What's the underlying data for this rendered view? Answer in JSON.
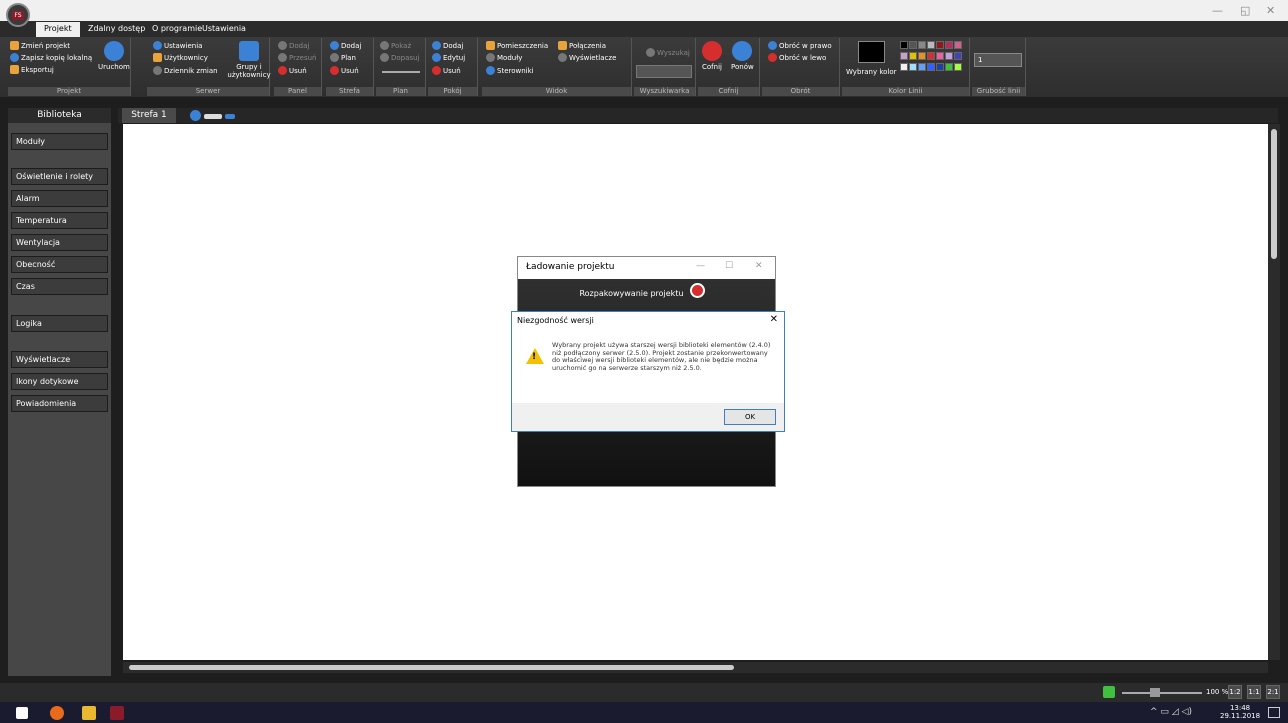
{
  "app": {
    "logo_text": "FS"
  },
  "window": {
    "minimize": "—",
    "restore": "◱",
    "close": "✕"
  },
  "menu": [
    "Projekt",
    "Zdalny dostęp",
    "O programie",
    "Ustawienia"
  ],
  "ribbon": {
    "projekt": {
      "label": "Projekt",
      "items": [
        "Zmień projekt",
        "Zapisz kopię lokalną",
        "Eksportuj",
        "Uruchom"
      ]
    },
    "serwer": {
      "label": "Serwer",
      "items": [
        "Ustawienia",
        "Użytkownicy",
        "Dziennik zmian",
        "Grupy i użytkownicy"
      ]
    },
    "panel": {
      "label": "Panel",
      "items": [
        "Dodaj",
        "Przesuń",
        "Usuń"
      ]
    },
    "strefa": {
      "label": "Strefa",
      "items": [
        "Dodaj",
        "Plan",
        "Usuń"
      ]
    },
    "plan": {
      "label": "Plan",
      "items": [
        "Pokaż",
        "Dopasuj"
      ]
    },
    "pokoj": {
      "label": "Pokój",
      "items": [
        "Dodaj",
        "Edytuj",
        "Usuń"
      ]
    },
    "widok": {
      "label": "Widok",
      "items": [
        "Pomieszczenia",
        "Połączenia",
        "Moduły",
        "Wyświetlacze",
        "Sterowniki"
      ]
    },
    "wyszukiwarka": {
      "label": "Wyszukiwarka",
      "items": [
        "Wyszukaj"
      ]
    },
    "cofnij": {
      "label": "Cofnij",
      "items": [
        "Cofnij",
        "Ponów"
      ]
    },
    "obrot": {
      "label": "Obrót",
      "items": [
        "Obróć w prawo",
        "Obróć w lewo"
      ]
    },
    "kolor": {
      "label": "Kolor Linii",
      "items": [
        "Wybrany kolor"
      ]
    },
    "grubosc": {
      "label": "Grubość linii",
      "value": "1"
    }
  },
  "palette": [
    "#000000",
    "#555555",
    "#888888",
    "#bbbbbb",
    "#8b1a1a",
    "#b03060",
    "#d06090",
    "#c8a0c8",
    "#e0c000",
    "#e89020",
    "#d03030",
    "#f060a0",
    "#c0a0e0",
    "#4040c0",
    "#f0f0f0",
    "#a0e0ff",
    "#60a0ff",
    "#3060ff",
    "#2040a0",
    "#40c040",
    "#a0ff40"
  ],
  "sidebar": {
    "header": "Biblioteka",
    "items": [
      "Moduły",
      "Oświetlenie i rolety",
      "Alarm",
      "Temperatura",
      "Wentylacja",
      "Obecność",
      "Czas",
      "Logika",
      "Wyświetlacze",
      "Ikony dotykowe",
      "Powiadomienia"
    ]
  },
  "tabs": [
    "Strefa 1"
  ],
  "loading": {
    "title": "Ładowanie projektu",
    "status": "Rozpakowywanie projektu"
  },
  "dialog": {
    "title": "Niezgodność wersji",
    "message": "Wybrany projekt używa starszej wersji biblioteki elementów (2.4.0) niż podłączony serwer (2.5.0). Projekt zostanie przekonwertowany do właściwej wersji biblioteki elementów, ale nie będzie można uruchomić go na serwerze starszym niż 2.5.0.",
    "ok": "OK"
  },
  "status": {
    "zoom": "100 %",
    "z12": "1:2",
    "z11": "1:1",
    "z21": "2:1"
  },
  "taskbar": {
    "time": "13:48",
    "date": "29.11.2018"
  }
}
